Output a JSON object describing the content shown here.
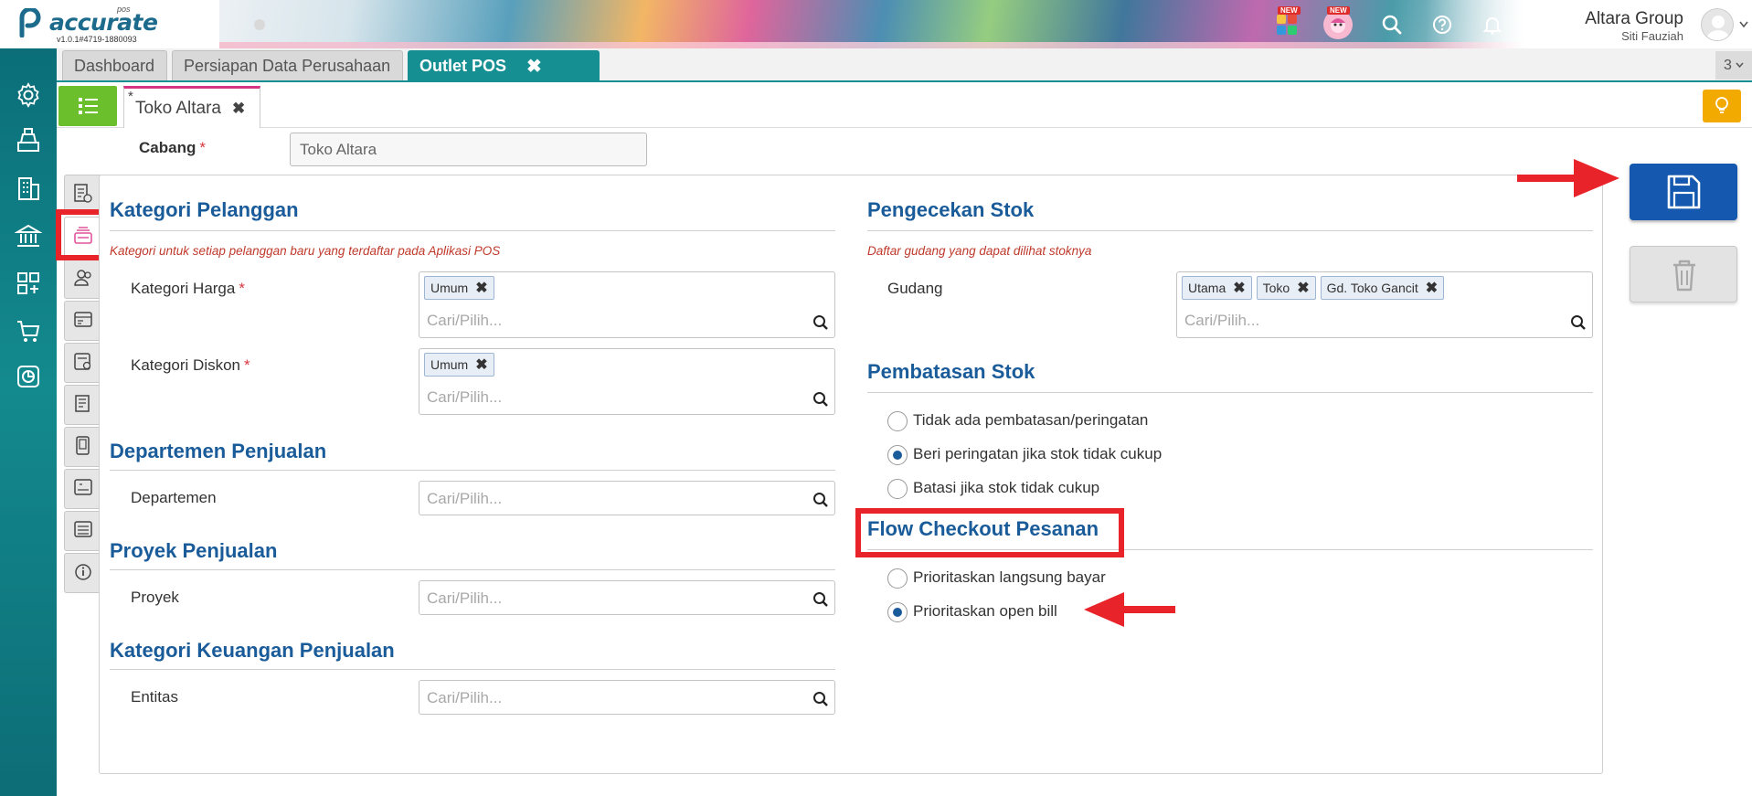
{
  "app": {
    "logo_text": "accurate",
    "logo_sub": "pos",
    "version": "v1.0.1#4719-1880093",
    "badge_new": "NEW",
    "company": "Altara Group",
    "user": "Siti Fauziah"
  },
  "tabs": {
    "items": [
      {
        "label": "Dashboard"
      },
      {
        "label": "Persiapan Data Perusahaan"
      },
      {
        "label": "Outlet POS"
      }
    ],
    "count": "3"
  },
  "subbar": {
    "record_tab": "Toko Altara",
    "unsaved_mark": "*"
  },
  "form": {
    "cabang_label": "Cabang",
    "cabang_value": "Toko Altara",
    "required_mark": "*",
    "placeholder": "Cari/Pilih..."
  },
  "left": {
    "kategori_pelanggan": {
      "title": "Kategori Pelanggan",
      "desc": "Kategori untuk setiap pelanggan baru yang terdaftar pada Aplikasi POS",
      "harga_label": "Kategori Harga",
      "harga_chip": "Umum",
      "diskon_label": "Kategori Diskon",
      "diskon_chip": "Umum"
    },
    "departemen": {
      "title": "Departemen Penjualan",
      "label": "Departemen"
    },
    "proyek": {
      "title": "Proyek Penjualan",
      "label": "Proyek"
    },
    "keuangan": {
      "title": "Kategori Keuangan Penjualan",
      "label": "Entitas"
    }
  },
  "right": {
    "pengecekan": {
      "title": "Pengecekan Stok",
      "desc": "Daftar gudang yang dapat dilihat stoknya",
      "gudang_label": "Gudang",
      "chips": [
        "Utama",
        "Toko",
        "Gd. Toko Gancit"
      ]
    },
    "pembatasan": {
      "title": "Pembatasan Stok",
      "options": [
        "Tidak ada pembatasan/peringatan",
        "Beri peringatan jika stok tidak cukup",
        "Batasi jika stok tidak cukup"
      ],
      "selected_index": 1
    },
    "flow": {
      "title": "Flow Checkout Pesanan",
      "options": [
        "Prioritaskan langsung bayar",
        "Prioritaskan open bill"
      ],
      "selected_index": 1
    }
  },
  "colors": {
    "accent": "#168f93",
    "section_title": "#1a5b9a",
    "save": "#1558b0",
    "highlight": "#e8232a"
  }
}
